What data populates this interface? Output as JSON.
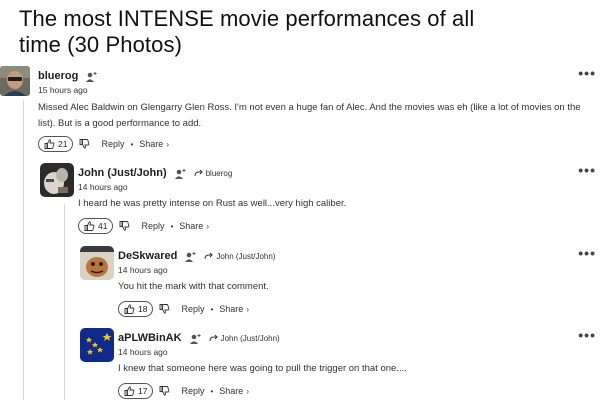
{
  "article": {
    "title": "The most INTENSE movie performances of all time (30 Photos)"
  },
  "labels": {
    "reply": "Reply",
    "share": "Share",
    "more": "•••"
  },
  "comments": [
    {
      "username": "bluerog",
      "reply_to": "",
      "time": "15 hours ago",
      "text": "Missed Alec Baldwin on Glengarry Glen Ross. I'm not even a huge fan of Alec. And the movies was eh (like a lot of movies on the list). But is a good performance to add.",
      "votes": "21"
    },
    {
      "username": "John (Just/John)",
      "reply_to": "bluerog",
      "time": "14 hours ago",
      "text": "I heard he was pretty intense on Rust as well...very high caliber.",
      "votes": "41"
    },
    {
      "username": "DeSkwared",
      "reply_to": "John (Just/John)",
      "time": "14 hours ago",
      "text": "You hit the mark with that comment.",
      "votes": "18"
    },
    {
      "username": "aPLWBinAK",
      "reply_to": "John (Just/John)",
      "time": "14 hours ago",
      "text": "I knew that someone here was going to pull the trigger on that one....",
      "votes": "17"
    }
  ]
}
